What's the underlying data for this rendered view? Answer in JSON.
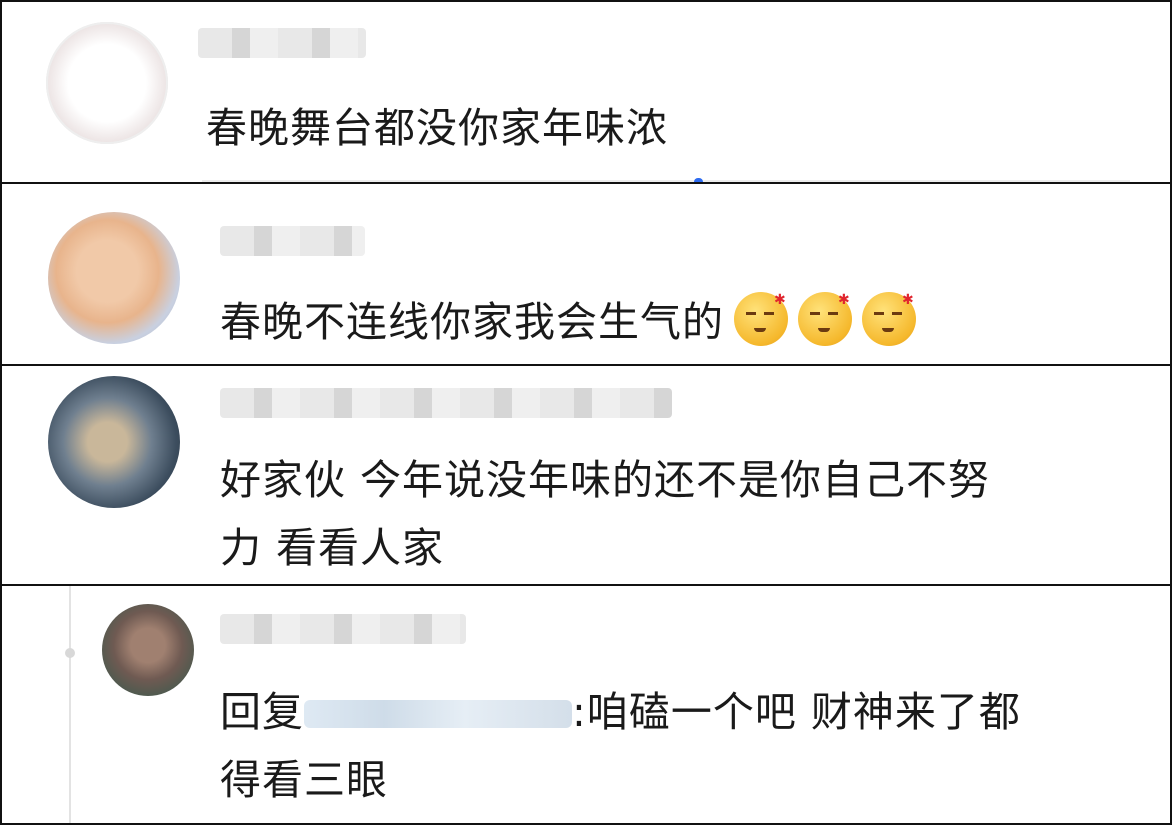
{
  "comments": [
    {
      "text": "春晚舞台都没你家年味浓"
    },
    {
      "text": "春晚不连线你家我会生气的",
      "emoji_icons": [
        "angry-face-icon",
        "angry-face-icon",
        "angry-face-icon"
      ]
    },
    {
      "line1": "好家伙 今年说没年味的还不是你自己不努",
      "line2": "力 看看人家"
    },
    {
      "reply_prefix": "回复",
      "line1_after_mention": ":咱磕一个吧  财神来了都",
      "line2": "得看三眼"
    }
  ],
  "colors": {
    "accent_dot": "#2d6bf0",
    "frame": "#111111"
  }
}
